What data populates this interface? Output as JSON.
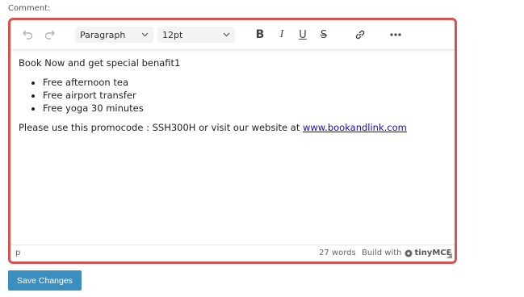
{
  "form": {
    "label": "Comment:",
    "save_label": "Save Changes"
  },
  "toolbar": {
    "undo_icon": "undo-icon",
    "redo_icon": "redo-icon",
    "block_format": "Paragraph",
    "font_size": "12pt",
    "bold_icon": "bold-icon",
    "italic_icon": "italic-icon",
    "underline_icon": "underline-icon",
    "strikethrough_icon": "strikethrough-icon",
    "link_icon": "link-icon",
    "more_icon": "more-icon"
  },
  "content": {
    "heading": "Book Now and get special benafit1",
    "items": [
      "Free afternoon tea",
      "Free airport transfer",
      "Free yoga 30 minutes"
    ],
    "promo_text": "Please use this promocode : SSH300H or visit our website at ",
    "link_text": "www.bookandlink.com"
  },
  "status": {
    "path": "p",
    "word_count": "27 words",
    "build_prefix": "Build with",
    "brand": "tinyMCE"
  },
  "colors": {
    "accent_border": "#d9534f",
    "button": "#3b8ec0",
    "link": "#1a0dab"
  }
}
